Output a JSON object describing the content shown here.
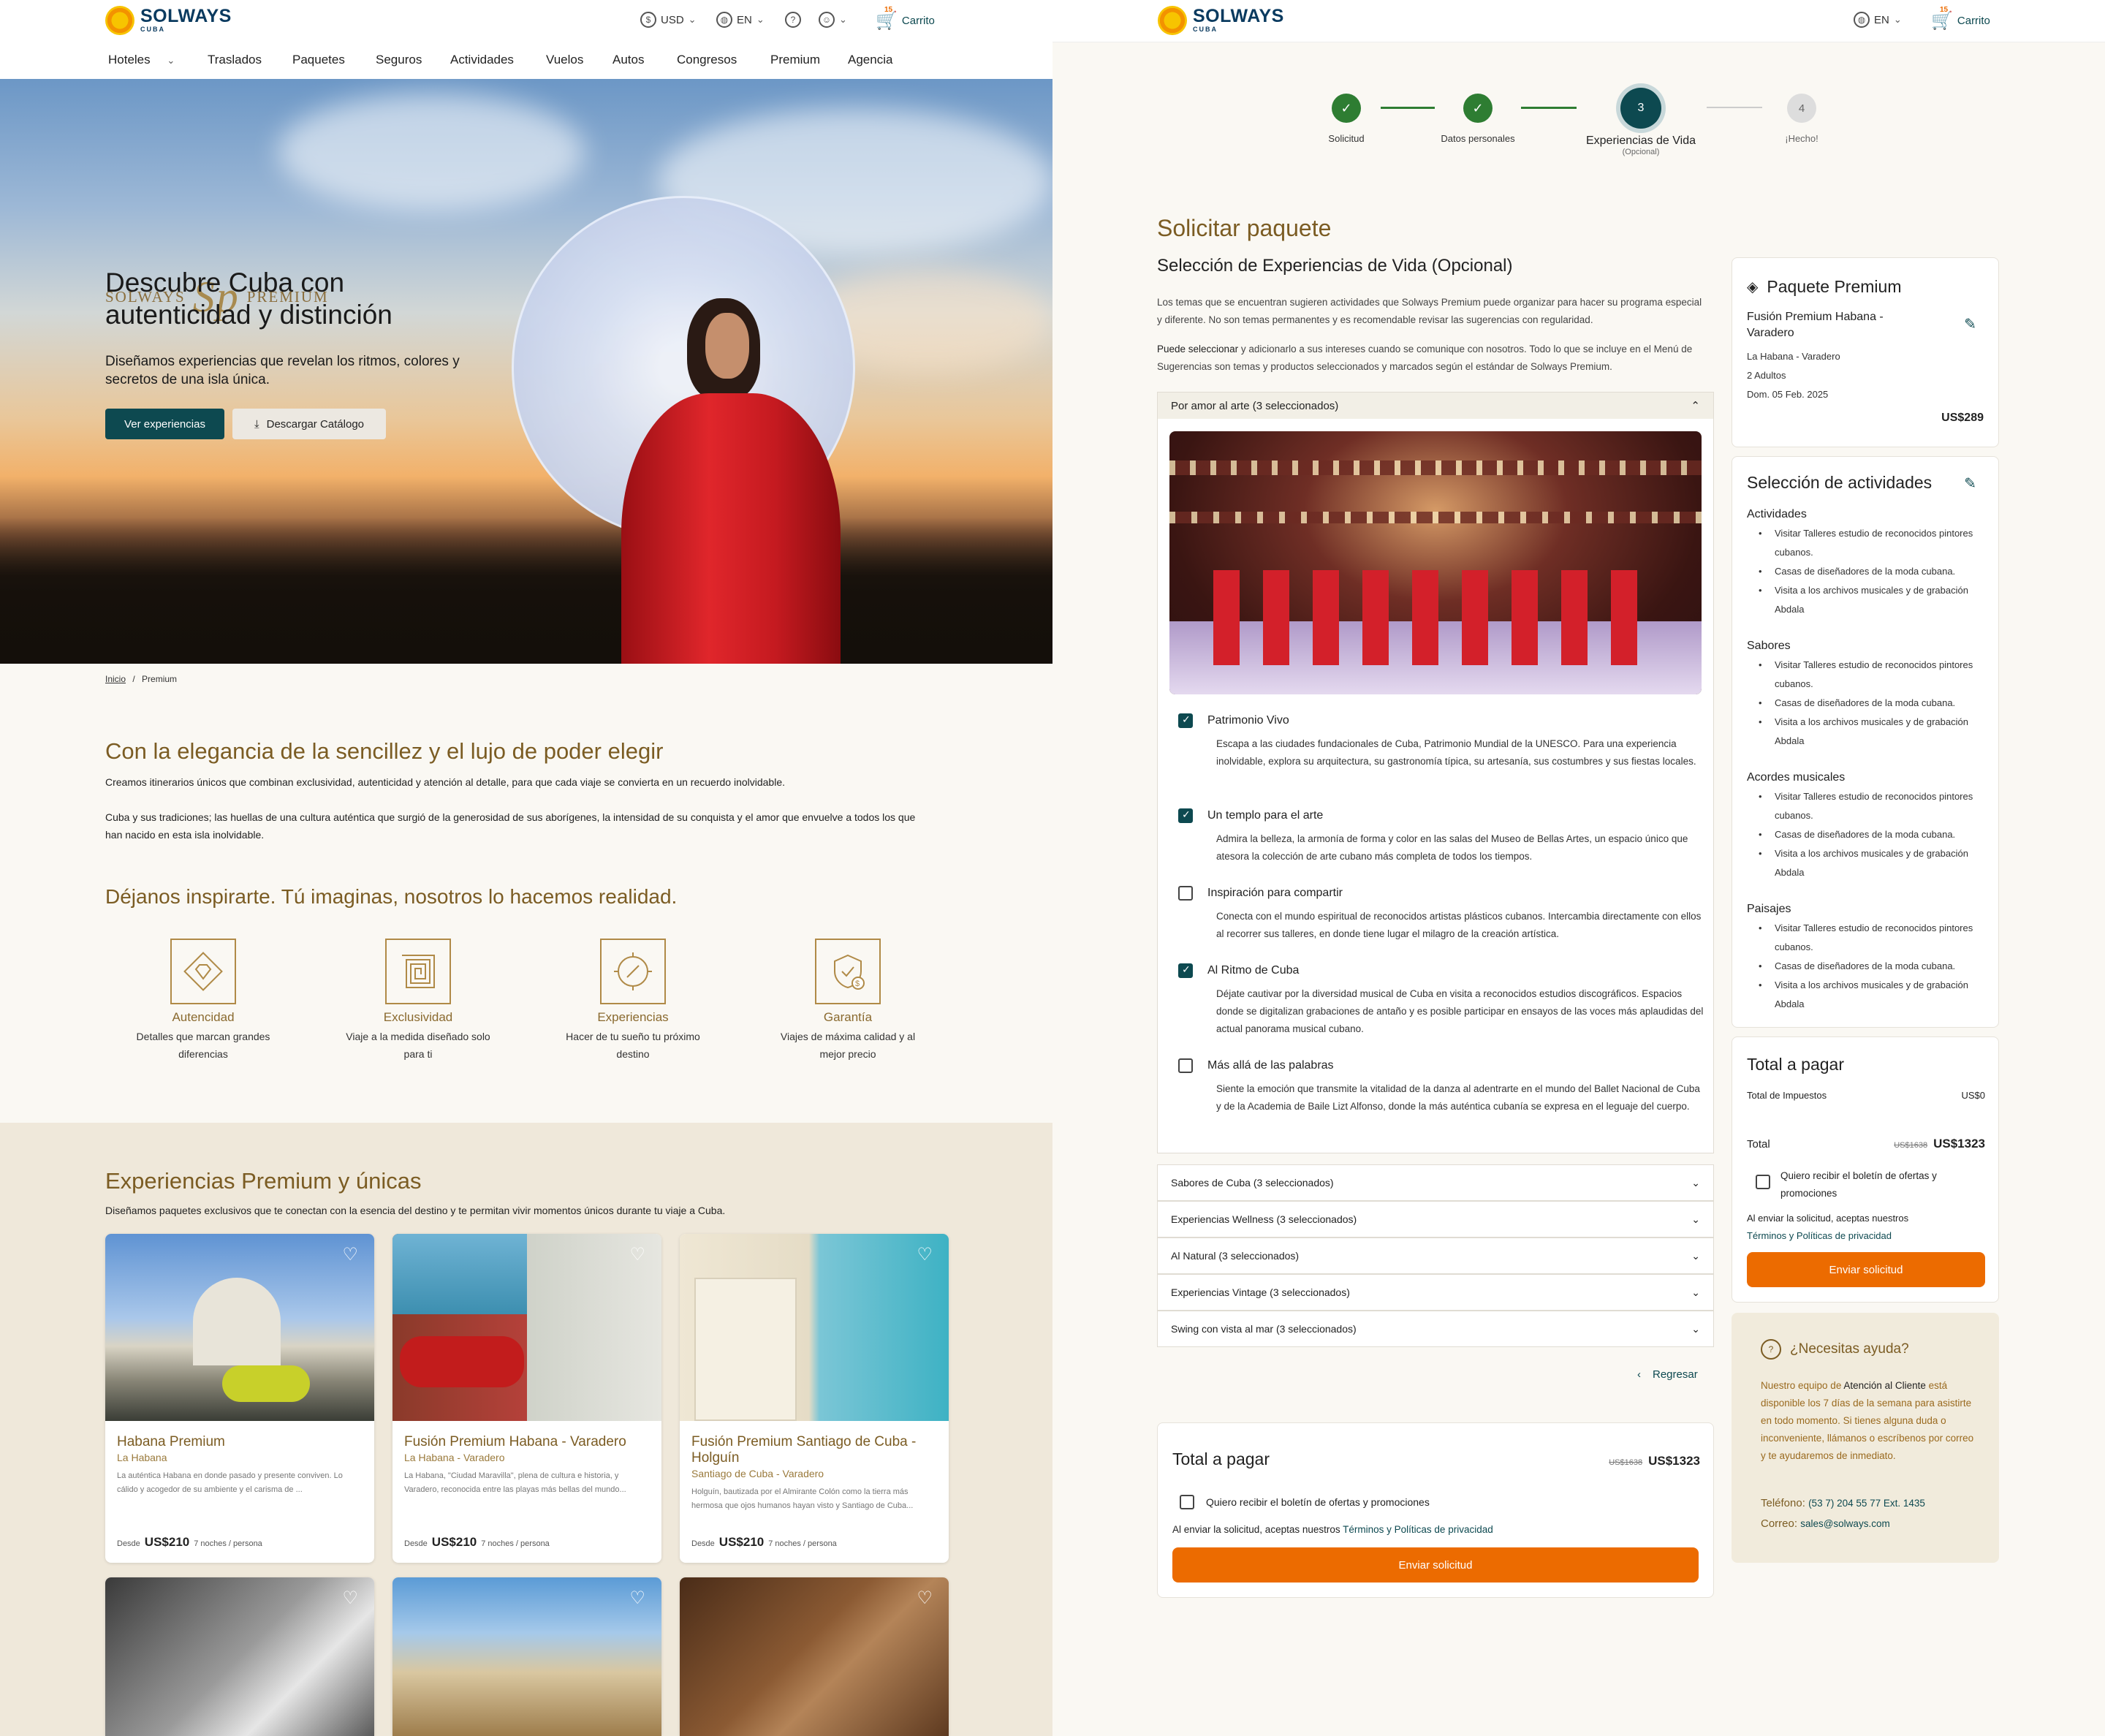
{
  "brand": {
    "name": "SOLWAYS",
    "sub": "CUBA"
  },
  "left": {
    "header": {
      "currency": "USD",
      "language": "EN",
      "cart": "Carrito",
      "cart_count": "15"
    },
    "nav": [
      "Hoteles",
      "Traslados",
      "Paquetes",
      "Seguros",
      "Actividades",
      "Vuelos",
      "Autos",
      "Congresos",
      "Premium",
      "Agencia"
    ],
    "nav_active": "Premium",
    "hero": {
      "logo_left": "SOLWAYS",
      "logo_mark": "Sp",
      "logo_right": "PREMIUM",
      "title_line1": "Descubre Cuba con",
      "title_line2": "autenticidad y distinción",
      "subtitle": "Diseñamos experiencias  que revelan los ritmos, colores y secretos de una isla única.",
      "btn_primary": "Ver experiencias",
      "btn_secondary": "Descargar Catálogo"
    },
    "breadcrumb": {
      "home": "Inicio",
      "sep": "/",
      "current": "Premium"
    },
    "intro": {
      "title": "Con la elegancia de la sencillez y el lujo de poder elegir",
      "p1": "Creamos itinerarios únicos que combinan exclusividad, autenticidad y atención al detalle, para que cada viaje se convierta en un recuerdo inolvidable.",
      "p2": "Cuba y sus tradiciones; las huellas de una cultura auténtica que surgió de la generosidad de sus aborígenes, la intensidad de su conquista y el amor que envuelve a todos los que han nacido en esta isla inolvidable."
    },
    "inspire": {
      "title": "Déjanos inspirarte. Tú imaginas, nosotros lo hacemos realidad."
    },
    "features": [
      {
        "icon": "diamond-icon",
        "title": "Autencidad",
        "desc": "Detalles que marcan grandes diferencias"
      },
      {
        "icon": "maze-icon",
        "title": "Exclusividad",
        "desc": "Viaje a la medida diseñado solo para ti"
      },
      {
        "icon": "compass-icon",
        "title": "Experiencias",
        "desc": "Hacer de tu sueño tu próximo destino"
      },
      {
        "icon": "shield-dollar-icon",
        "title": "Garantía",
        "desc": "Viajes de máxima calidad y al mejor precio"
      }
    ],
    "experiences": {
      "title": "Experiencias Premium y únicas",
      "subtitle": "Diseñamos paquetes exclusivos que te conectan con la esencia del destino y te permitan vivir momentos únicos durante tu viaje a Cuba.",
      "cards": [
        {
          "title": "Habana Premium",
          "location": "La Habana",
          "desc": "La auténtica Habana en donde pasado y presente conviven. Lo cálido y acogedor de su ambiente y el carisma de ...",
          "from": "Desde",
          "price": "US$210",
          "nights": "7 noches / persona"
        },
        {
          "title": "Fusión Premium Habana - Varadero",
          "location": "La Habana - Varadero",
          "desc": "La Habana, \"Ciudad Maravilla\", plena de cultura e historia, y Varadero, reconocida entre las playas más bellas del mundo...",
          "from": "Desde",
          "price": "US$210",
          "nights": "7 noches / persona"
        },
        {
          "title": "Fusión Premium Santiago de Cuba - Holguín",
          "location": "Santiago de Cuba - Varadero",
          "desc": "Holguín, bautizada por el Almirante Colón como la tierra más hermosa que ojos humanos hayan visto y Santiago de Cuba...",
          "from": "Desde",
          "price": "US$210",
          "nights": "7 noches / persona"
        }
      ]
    },
    "colors": {
      "gold": "#7b5c23",
      "teal": "#0d4950",
      "accent": "#ec6b00"
    }
  },
  "right": {
    "header": {
      "language": "EN",
      "cart": "Carrito",
      "cart_count": "15"
    },
    "steps": [
      {
        "label": "Solicitud",
        "state": "done"
      },
      {
        "label": "Datos personales",
        "state": "done"
      },
      {
        "number": "3",
        "label": "Experiencias de Vida",
        "note": "(Opcional)",
        "state": "active"
      },
      {
        "number": "4",
        "label": "¡Hecho!",
        "state": "pending"
      }
    ],
    "page_title": "Solicitar paquete",
    "section_title": "Selección de Experiencias de Vida (Opcional)",
    "intro1": "Los temas que se encuentran sugieren actividades que Solways Premium puede organizar para hacer su programa especial y diferente. No son temas permanentes y es recomendable revisar las sugerencias con regularidad.",
    "intro2_bold": "Puede seleccionar",
    "intro2": " y adicionarlo a sus intereses cuando se comunique con nosotros. Todo lo que se incluye en el Menú de Sugerencias son temas y productos seleccionados y marcados según el estándar de Solways Premium.",
    "open_accordion": {
      "label": "Por amor al arte",
      "count": "(3 seleccionados)"
    },
    "experiences": [
      {
        "title": "Patrimonio Vivo",
        "checked": true,
        "desc": "Escapa a las ciudades fundacionales de Cuba, Patrimonio Mundial de la UNESCO. Para una experiencia inolvidable, explora su arquitectura, su gastronomía típica, su artesanía, sus costumbres y sus fiestas locales."
      },
      {
        "title": "Un templo para el arte",
        "checked": true,
        "desc": "Admira la belleza, la armonía de forma y color en las salas del Museo de Bellas Artes, un espacio único que atesora la colección de arte cubano más completa de todos los tiempos."
      },
      {
        "title": "Inspiración para compartir",
        "checked": false,
        "desc": "Conecta con el mundo espiritual de reconocidos artistas plásticos cubanos. Intercambia directamente con ellos al recorrer sus talleres, en donde tiene lugar el milagro de la creación artística."
      },
      {
        "title": "Al Ritmo de Cuba",
        "checked": true,
        "desc": "Déjate cautivar por la diversidad musical de Cuba en visita a reconocidos estudios discográficos. Espacios donde se digitalizan grabaciones de antaño y es posible participar en ensayos de las voces más aplaudidas del actual panorama musical cubano."
      },
      {
        "title": "Más allá de las palabras",
        "checked": false,
        "desc": "Siente la emoción que transmite la vitalidad de la danza al adentrarte en el mundo del Ballet Nacional de Cuba y de la Academia de Baile Lizt Alfonso, donde la más auténtica cubanía se expresa en el leguaje del cuerpo."
      }
    ],
    "accordions": [
      "Sabores de Cuba (3 seleccionados)",
      "Experiencias Wellness (3 seleccionados)",
      "Al Natural (3 seleccionados)",
      "Experiencias Vintage (3 seleccionados)",
      "Swing con vista al mar (3 seleccionados)"
    ],
    "back": "Regresar",
    "bottom_total": {
      "title": "Total a pagar",
      "old": "US$1638",
      "price": "US$1323",
      "newsletter": "Quiero recibir el boletín de ofertas y promociones",
      "terms_prefix": "Al enviar la solicitud, aceptas nuestros ",
      "terms_link": "Términos y Políticas de privacidad",
      "submit": "Enviar solicitud"
    },
    "package": {
      "title": "Paquete Premium",
      "name": "Fusión Premium Habana - Varadero",
      "route": "La Habana - Varadero",
      "pax": "2 Adultos",
      "date": "Dom. 05 Feb. 2025",
      "price": "US$289"
    },
    "activities": {
      "title": "Selección de actividades",
      "groups": [
        {
          "name": "Actividades",
          "items": [
            "Visitar Talleres estudio de reconocidos pintores cubanos.",
            "Casas de diseñadores de la moda cubana.",
            "Visita a los archivos musicales y de grabación Abdala"
          ]
        },
        {
          "name": "Sabores",
          "items": [
            "Visitar Talleres estudio de reconocidos pintores cubanos.",
            "Casas de diseñadores de la moda cubana.",
            "Visita a los archivos musicales y de grabación Abdala"
          ]
        },
        {
          "name": "Acordes musicales",
          "items": [
            "Visitar Talleres estudio de reconocidos pintores cubanos.",
            "Casas de diseñadores de la moda cubana.",
            "Visita a los archivos musicales y de grabación Abdala"
          ]
        },
        {
          "name": "Paisajes",
          "items": [
            "Visitar Talleres estudio de reconocidos pintores cubanos.",
            "Casas de diseñadores de la moda cubana.",
            "Visita a los archivos musicales y de grabación Abdala"
          ]
        }
      ]
    },
    "side_total": {
      "title": "Total a pagar",
      "tax_label": "Total de Impuestos",
      "tax": "US$0",
      "total_label": "Total",
      "old": "US$1638",
      "price": "US$1323",
      "newsletter": "Quiero recibir el boletín de ofertas y promociones",
      "terms_prefix": "Al enviar la solicitud, aceptas nuestros",
      "terms_link": "Términos y Políticas de privacidad",
      "submit": "Enviar solicitud"
    },
    "help": {
      "title": "¿Necesitas ayuda?",
      "text1": "Nuestro equipo de ",
      "text_bold": "Atención al Cliente",
      "text2": " está disponible los 7 días de la semana para asistirte en todo momento. Si tienes alguna duda o inconveniente, llámanos o escríbenos por correo y te ayudaremos de inmediato.",
      "phone_label": "Teléfono:",
      "phone": "(53 7) 204 55 77 Ext. 1435",
      "mail_label": "Correo:",
      "mail": "sales@solways.com"
    }
  }
}
